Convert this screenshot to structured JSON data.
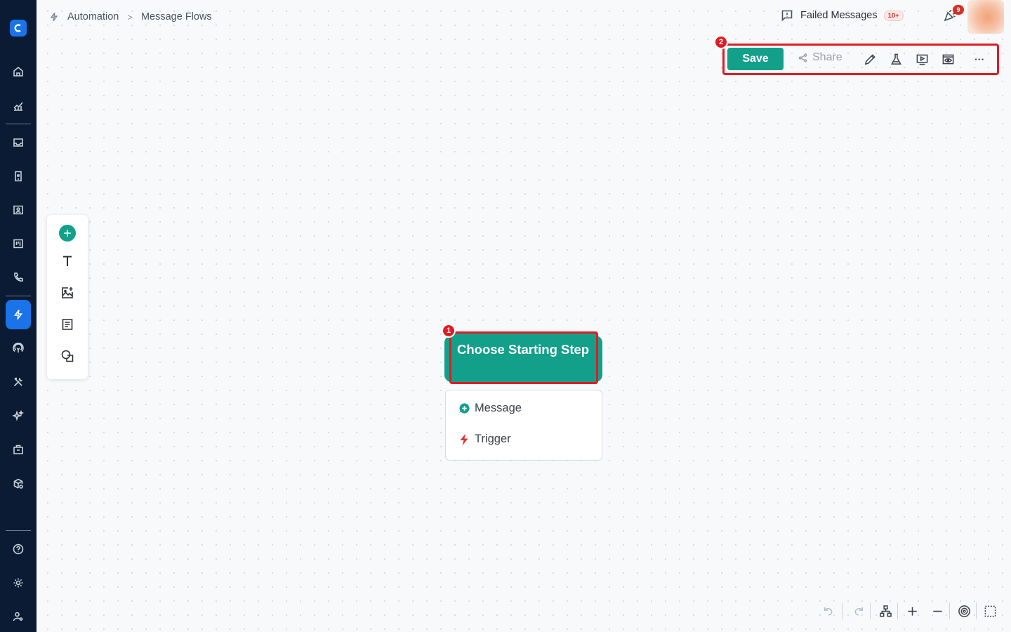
{
  "breadcrumb": {
    "section": "Automation",
    "separator": ">",
    "page": "Message Flows"
  },
  "header": {
    "failed_messages_label": "Failed Messages",
    "failed_messages_count": "10+",
    "notifications_count": "9"
  },
  "toolbar": {
    "save_label": "Save",
    "share_label": "Share"
  },
  "annotations": {
    "node_marker": "1",
    "toolbar_marker": "2"
  },
  "node": {
    "title": "Choose Starting Step",
    "options": [
      {
        "label": "Message",
        "icon": "message-add-icon"
      },
      {
        "label": "Trigger",
        "icon": "lightning-icon"
      }
    ]
  },
  "colors": {
    "accent": "#13a08a",
    "sidebar": "#0b1b33",
    "active_nav": "#1a73e8",
    "highlight": "#e01b24"
  }
}
